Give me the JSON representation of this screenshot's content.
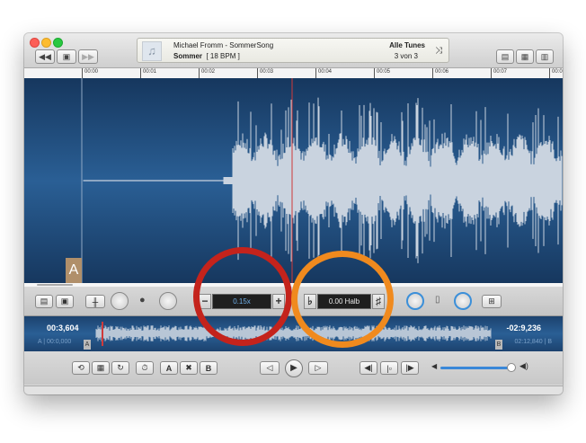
{
  "track": {
    "artist_title": "Michael Fromm - SommerSong",
    "album": "Sommer",
    "bpm": "[ 18 BPM ]",
    "playlist": "Alle Tunes",
    "position": "3 von 3"
  },
  "ruler_ticks": [
    "00:00",
    "00:01",
    "00:02",
    "00:03",
    "00:04",
    "00:05",
    "00:06",
    "00:07",
    "00:0"
  ],
  "marker_a_label": "A",
  "speed": {
    "value": "0.15x",
    "minus": "−",
    "plus": "+"
  },
  "pitch": {
    "value": "0.00 Halb",
    "flat": "♭",
    "sharp": "♯"
  },
  "overview": {
    "elapsed": "00:3,604",
    "remaining": "-02:9,236",
    "loop_start": "A | 00:0,000",
    "loop_end": "02:12,840 | B",
    "badge_a": "A",
    "badge_b": "B"
  },
  "transport": {
    "btn_a": "A",
    "btn_x": "✖",
    "btn_b": "B",
    "prev": "◁",
    "play": "▶",
    "next": "▷"
  },
  "volume_level": 0.95,
  "colors": {
    "waveform_bg": "#1f4a7a",
    "playhead": "#d03a3a",
    "annotation_red": "#c4231c",
    "annotation_orange": "#f08a1e",
    "accent_blue": "#3b8fd9"
  }
}
